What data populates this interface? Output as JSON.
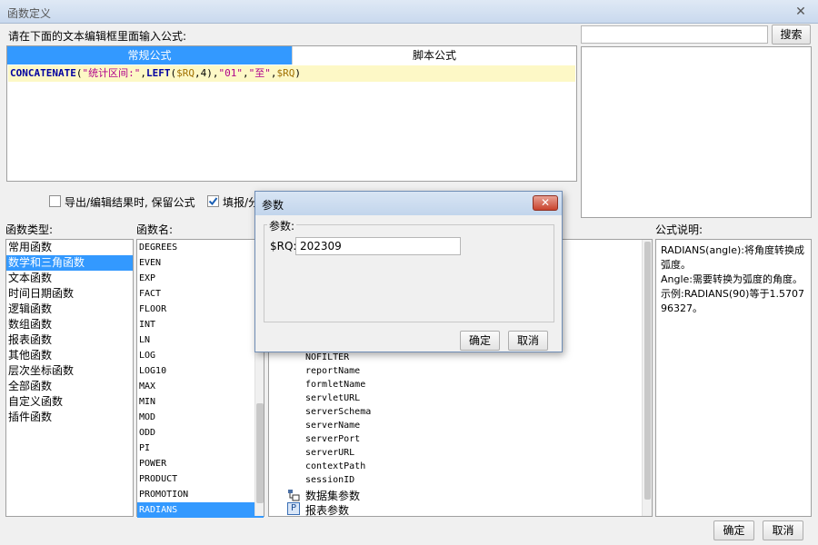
{
  "window": {
    "title": "函数定义",
    "close_glyph": "✕"
  },
  "prompt_label": "请在下面的文本编辑框里面输入公式:",
  "search": {
    "value": "",
    "button": "搜索"
  },
  "tabs": [
    {
      "label": "常规公式",
      "active": true
    },
    {
      "label": "脚本公式",
      "active": false
    }
  ],
  "editor": {
    "tokens": [
      {
        "text": "CONCATENATE",
        "kind": "kw"
      },
      {
        "text": "(",
        "kind": "plain"
      },
      {
        "text": "\"统计区间:\"",
        "kind": "str"
      },
      {
        "text": ",",
        "kind": "plain"
      },
      {
        "text": "LEFT",
        "kind": "kw"
      },
      {
        "text": "(",
        "kind": "plain"
      },
      {
        "text": "$RQ",
        "kind": "var"
      },
      {
        "text": ",4)",
        "kind": "plain"
      },
      {
        "text": ",",
        "kind": "plain"
      },
      {
        "text": "\"01\"",
        "kind": "str"
      },
      {
        "text": ",",
        "kind": "plain"
      },
      {
        "text": "\"至\"",
        "kind": "str"
      },
      {
        "text": ",",
        "kind": "plain"
      },
      {
        "text": "$RQ",
        "kind": "var"
      },
      {
        "text": ")",
        "kind": "plain"
      }
    ]
  },
  "options": {
    "keep_formula": {
      "label": "导出/编辑结果时, 保留公式",
      "checked": false
    },
    "fill_option": {
      "label": "填报/分",
      "checked": true
    }
  },
  "function_types": {
    "header": "函数类型:",
    "items": [
      "常用函数",
      "数学和三角函数",
      "文本函数",
      "时间日期函数",
      "逻辑函数",
      "数组函数",
      "报表函数",
      "其他函数",
      "层次坐标函数",
      "全部函数",
      "自定义函数",
      "插件函数"
    ],
    "selected": 1
  },
  "function_names": {
    "header": "函数名:",
    "items": [
      "DEGREES",
      "EVEN",
      "EXP",
      "FACT",
      "FLOOR",
      "INT",
      "LN",
      "LOG",
      "LOG10",
      "MAX",
      "MIN",
      "MOD",
      "ODD",
      "PI",
      "POWER",
      "PRODUCT",
      "PROMOTION",
      "RADIANS"
    ],
    "selected": 17
  },
  "params_tree": {
    "items": [
      "NOFILTER",
      "reportName",
      "formletName",
      "servletURL",
      "serverSchema",
      "serverName",
      "serverPort",
      "serverURL",
      "contextPath",
      "sessionID"
    ],
    "groups": [
      {
        "label": "数据集参数",
        "icon": "dataset-param-icon"
      },
      {
        "label": "报表参数",
        "icon": "report-param-icon",
        "glyph": "P"
      }
    ]
  },
  "description": {
    "header": "公式说明:",
    "lines": [
      "RADIANS(angle):将角度转换成弧度。",
      "Angle:需要转换为弧度的角度。",
      "示例:RADIANS(90)等于1.570796327。"
    ]
  },
  "footer": {
    "ok": "确定",
    "cancel": "取消"
  },
  "param_dialog": {
    "title": "参数",
    "close_glyph": "✕",
    "group_label": "参数:",
    "field_label": "$RQ:",
    "field_value": "202309",
    "ok": "确定",
    "cancel": "取消"
  }
}
